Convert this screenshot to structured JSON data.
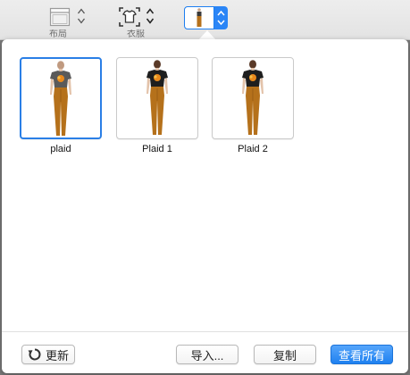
{
  "toolbar": {
    "tools": [
      {
        "name": "layout-tool",
        "label": "布局"
      },
      {
        "name": "outfit-tool",
        "label": "衣服"
      },
      {
        "name": "preset-tool",
        "label": ""
      }
    ]
  },
  "presets": {
    "items": [
      {
        "label": "plaid",
        "selected": true
      },
      {
        "label": "Plaid 1",
        "selected": false
      },
      {
        "label": "Plaid 2",
        "selected": false
      }
    ]
  },
  "footer": {
    "refresh_label": "更新",
    "import_label": "导入...",
    "copy_label": "复制",
    "view_all_label": "查看所有"
  },
  "colors": {
    "accent": "#2a85f6",
    "pants": "#b5711b",
    "shirt_selected": "#5a5a5a",
    "shirt": "#1e1e1e",
    "print": "#e9891c"
  }
}
